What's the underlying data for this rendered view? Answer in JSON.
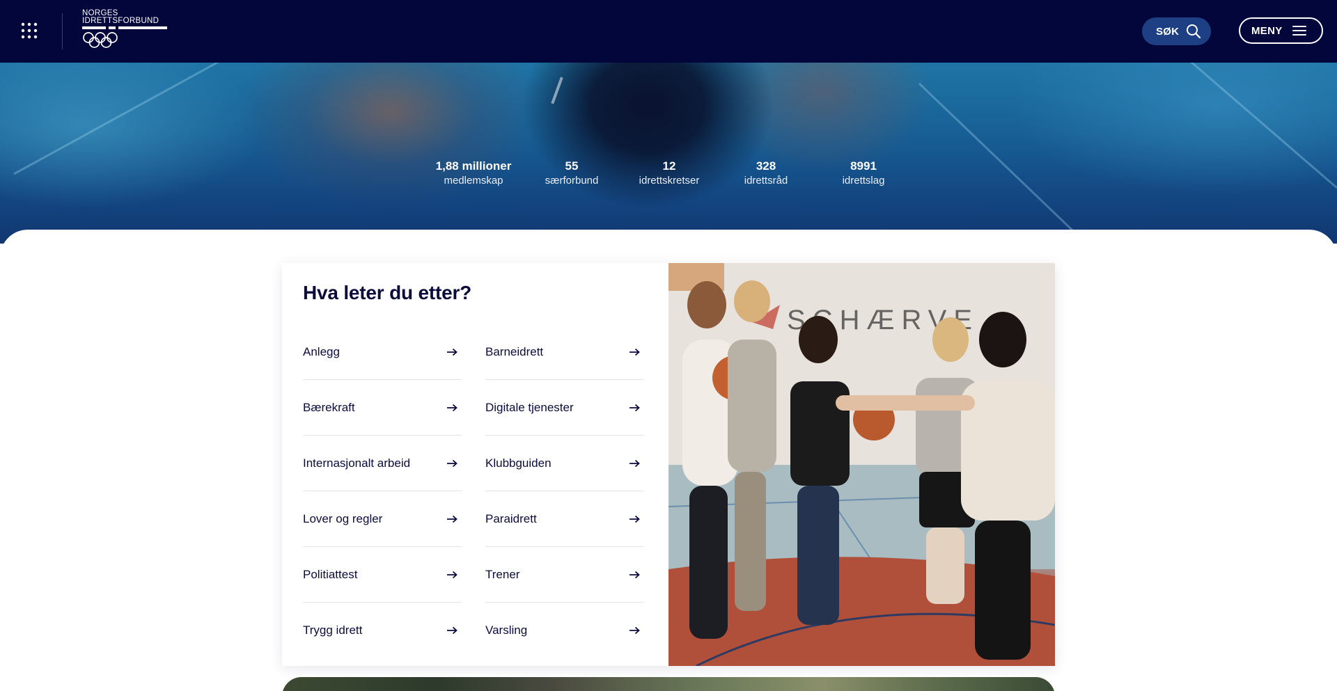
{
  "header": {
    "apps_icon": "apps-grid-icon",
    "logo": {
      "line1": "NORGES",
      "line2": "IDRETTSFORBUND",
      "rings_icon": "olympic-rings-icon"
    },
    "search_label": "SØK",
    "search_icon": "magnifier-icon",
    "menu_label": "MENY",
    "menu_icon": "hamburger-icon",
    "colors": {
      "background": "#03063a",
      "search_button": "#1e3f83"
    }
  },
  "stats": [
    {
      "value": "1,88 millioner",
      "caption": "medlemskap"
    },
    {
      "value": "55",
      "caption": "særforbund"
    },
    {
      "value": "12",
      "caption": "idrettskretser"
    },
    {
      "value": "328",
      "caption": "idrettsråd"
    },
    {
      "value": "8991",
      "caption": "idrettslag"
    }
  ],
  "quicklinks": {
    "title": "Hva leter du etter?",
    "left": [
      "Anlegg",
      "Bærekraft",
      "Internasjonalt arbeid",
      "Lover og regler",
      "Politiattest",
      "Trygg idrett"
    ],
    "right": [
      "Barneidrett",
      "Digitale tjenester",
      "Klubbguiden",
      "Paraidrett",
      "Trener",
      "Varsling"
    ],
    "arrow_icon": "arrow-right-icon"
  },
  "photo": {
    "subject": "children-basketball-photo",
    "wall_text": "SCHÆRVE"
  }
}
